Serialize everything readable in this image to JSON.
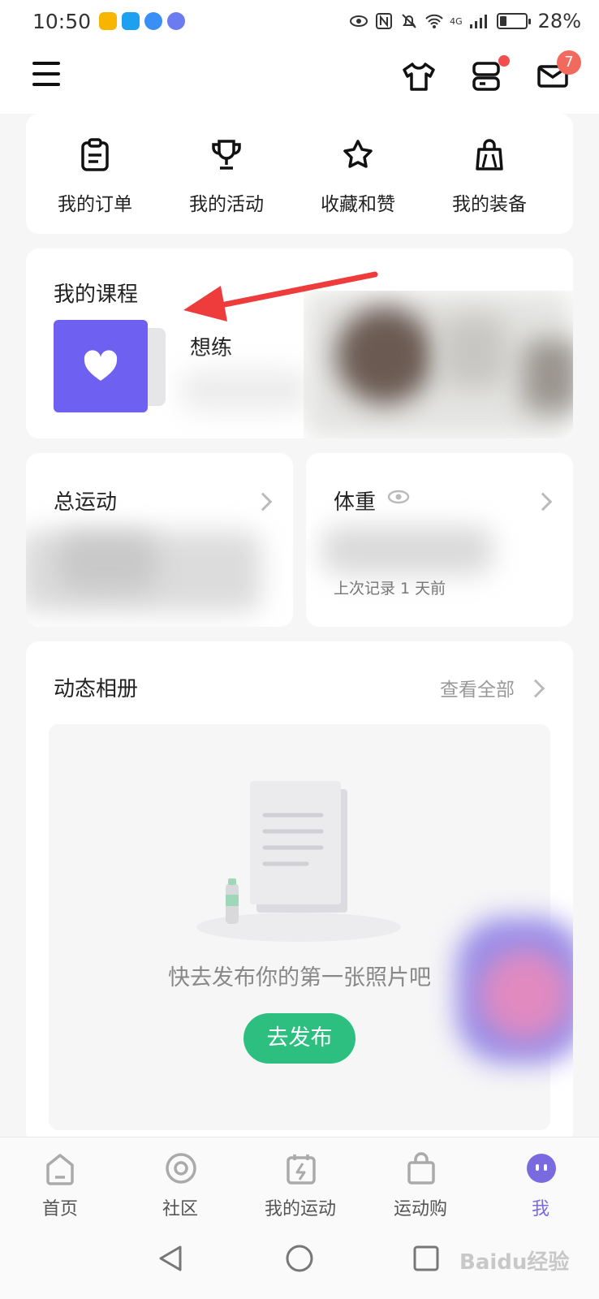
{
  "status_bar": {
    "time": "10:50",
    "battery": "28%",
    "network": "4G",
    "app_icons": [
      "weibo-icon",
      "qq-browser-icon",
      "browser-icon",
      "music-icon"
    ],
    "colors": {
      "weibo": "#f7b500",
      "qq": "#1ea0f0",
      "browser": "#3a8ff7",
      "music": "#6c7bf0"
    }
  },
  "topbar": {
    "message_badge": "7",
    "icons": [
      "menu-icon",
      "tshirt-icon",
      "device-icon",
      "mail-icon"
    ]
  },
  "shortcuts": [
    {
      "label": "我的订单",
      "icon": "clipboard-icon"
    },
    {
      "label": "我的活动",
      "icon": "trophy-icon"
    },
    {
      "label": "收藏和赞",
      "icon": "star-icon"
    },
    {
      "label": "我的装备",
      "icon": "bag-icon"
    }
  ],
  "courses": {
    "title": "我的课程",
    "item_label": "想练",
    "item_color": "#6e60f0"
  },
  "stats": {
    "total": {
      "title": "总运动"
    },
    "weight": {
      "title": "体重",
      "subtitle": "上次记录 1 天前"
    }
  },
  "album": {
    "title": "动态相册",
    "view_all": "查看全部",
    "empty_text": "快去发布你的第一张照片吧",
    "publish_button": "去发布",
    "button_color": "#2dbf80"
  },
  "tabs": [
    {
      "label": "首页",
      "icon": "home-icon"
    },
    {
      "label": "社区",
      "icon": "community-icon"
    },
    {
      "label": "我的运动",
      "icon": "calendar-bolt-icon"
    },
    {
      "label": "运动购",
      "icon": "shopping-bag-icon"
    },
    {
      "label": "我",
      "icon": "me-icon",
      "active": true
    }
  ],
  "accent_color": "#7a6ae0",
  "watermark": "Baidu经验"
}
